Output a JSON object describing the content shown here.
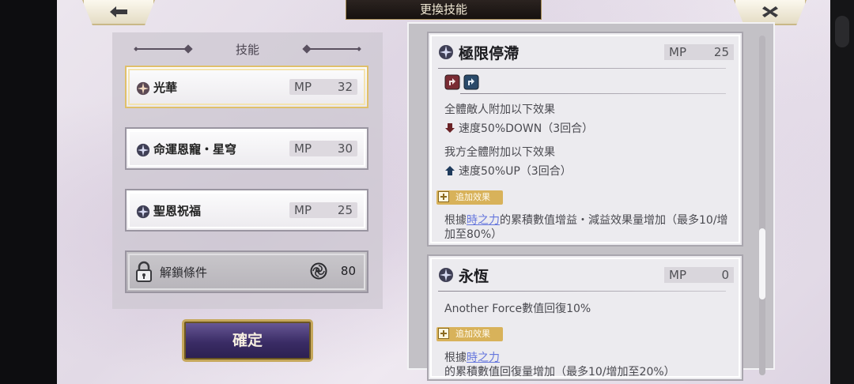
{
  "header": {
    "title": "更換技能",
    "back_icon": "back-arrow-icon",
    "close_icon": "close-x-icon"
  },
  "left_panel": {
    "title": "技能",
    "skills": [
      {
        "name": "光華",
        "mp_label": "MP",
        "mp": "32",
        "selected": true,
        "icon": "skill-gear-icon"
      },
      {
        "name": "命運恩寵・星穹",
        "mp_label": "MP",
        "mp": "30",
        "selected": false,
        "icon": "skill-gear-icon"
      },
      {
        "name": "聖恩祝福",
        "mp_label": "MP",
        "mp": "25",
        "selected": false,
        "icon": "skill-gear-icon"
      }
    ],
    "locked_slot": {
      "label": "解鎖條件",
      "cost": "80",
      "icon": "lock-icon",
      "cost_icon": "spiral-token-icon"
    },
    "confirm_label": "確定"
  },
  "detail_cards": [
    {
      "title": "極限停滯",
      "mp_label": "MP",
      "mp": "25",
      "lines": [
        "全體敵人附加以下效果",
        "速度50%DOWN（3回合）",
        "我方全體附加以下效果",
        "速度50%UP（3回合）"
      ],
      "badge": "追加效果",
      "extra_prefix": "根據",
      "extra_link": "時之力",
      "extra_suffix": "的累積數值增益・減益效果量增加（最多10/增加至80%）"
    },
    {
      "title": "永恆",
      "mp_label": "MP",
      "mp": "0",
      "lines": [
        "Another Force數值回復10%"
      ],
      "badge": "追加效果",
      "extra_prefix": "根據",
      "extra_link": "時之力",
      "extra_suffix": "的累積數值回復量增加（最多10/增加至20%）"
    }
  ],
  "colors": {
    "accent_gold": "#d8b25a",
    "link_blue": "#6677dd",
    "debuff_red": "#7a2424",
    "buff_blue": "#1e3a5c"
  }
}
